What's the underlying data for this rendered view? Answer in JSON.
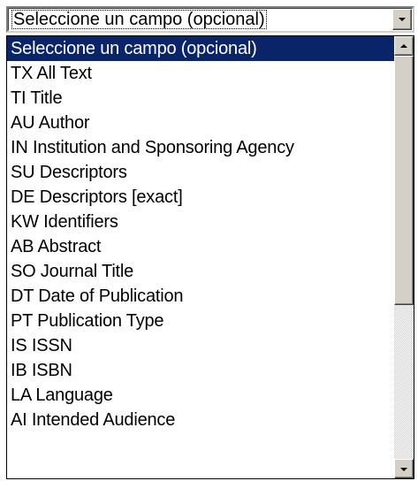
{
  "select": {
    "selected_label": "Seleccione un campo (opcional)"
  },
  "options": [
    {
      "label": "Seleccione un campo (opcional)",
      "selected": true
    },
    {
      "label": "TX All Text"
    },
    {
      "label": "TI Title"
    },
    {
      "label": "AU Author"
    },
    {
      "label": "IN Institution and Sponsoring Agency"
    },
    {
      "label": "SU Descriptors"
    },
    {
      "label": "DE Descriptors [exact]"
    },
    {
      "label": "KW Identifiers"
    },
    {
      "label": "AB Abstract"
    },
    {
      "label": "SO Journal Title"
    },
    {
      "label": "DT Date of Publication"
    },
    {
      "label": "PT Publication Type"
    },
    {
      "label": "IS ISSN"
    },
    {
      "label": "IB ISBN"
    },
    {
      "label": "LA Language"
    },
    {
      "label": "AI Intended Audience"
    }
  ],
  "colors": {
    "highlight": "#0a246a",
    "highlight_text": "#ffffff",
    "chrome": "#d4d0c8"
  },
  "icons": {
    "select_arrow": "chevron-down-icon",
    "scroll_up": "arrow-up-icon",
    "scroll_down": "arrow-down-icon"
  }
}
